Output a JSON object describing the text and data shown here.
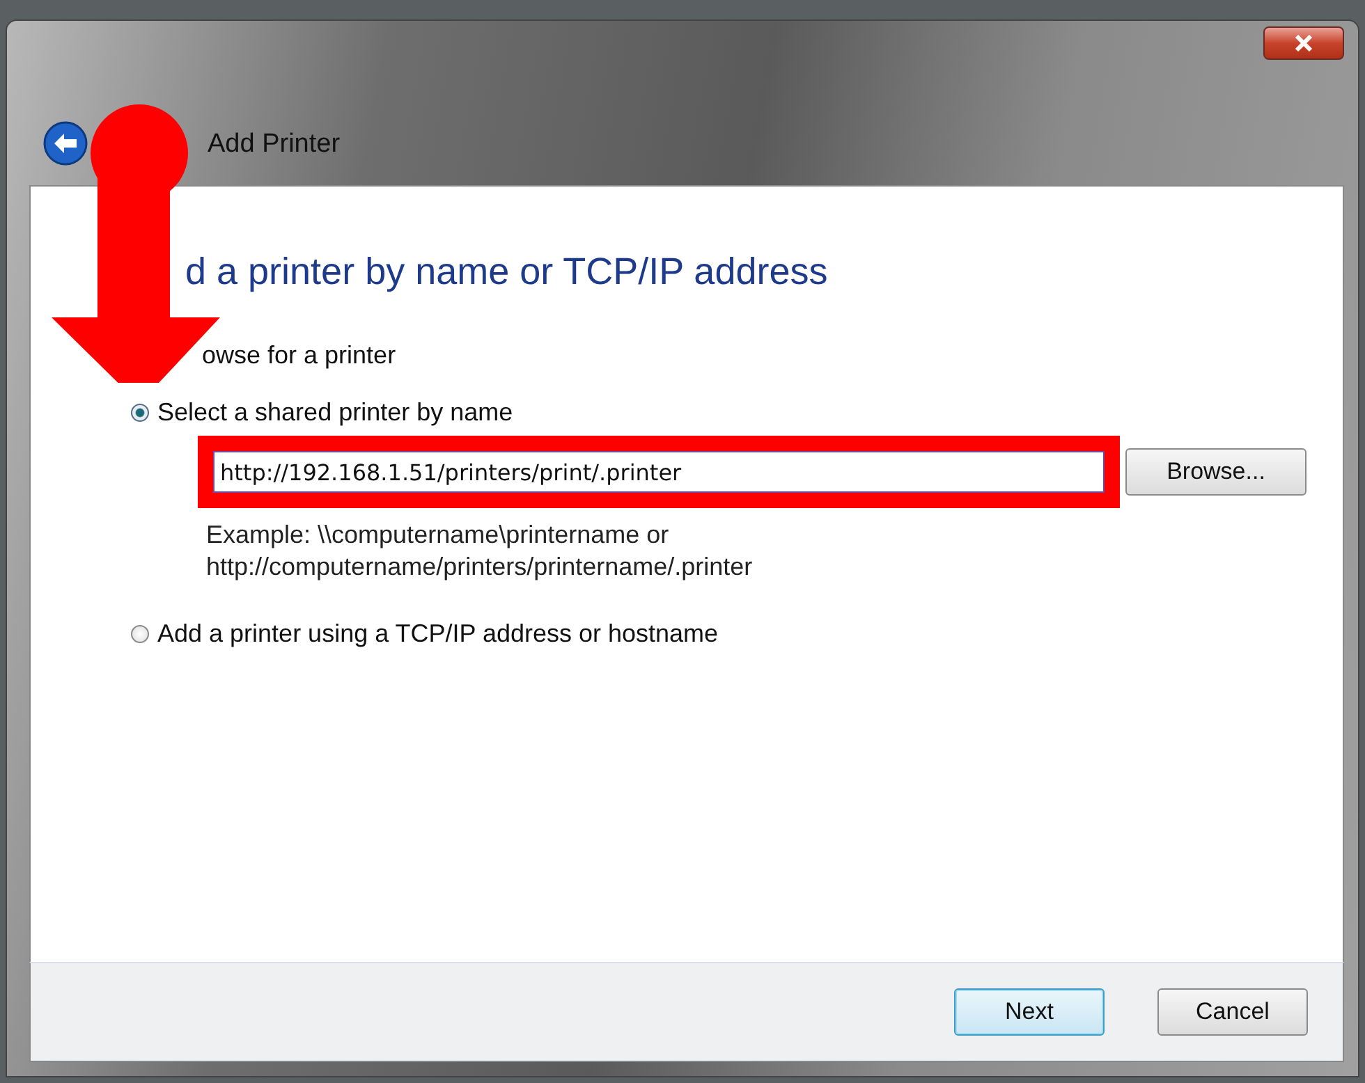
{
  "window": {
    "title": "Add Printer"
  },
  "heading": "d a printer by name or TCP/IP address",
  "partial_option_label": "owse for a printer",
  "options": [
    {
      "label": "Select a shared printer by name",
      "selected": true
    },
    {
      "label": "Add a printer using a TCP/IP address or hostname",
      "selected": false
    }
  ],
  "printer_field": {
    "value": "http://192.168.1.51/printers/print/.printer"
  },
  "browse_button": "Browse...",
  "example_lines": [
    "Example: \\\\computername\\printername or",
    "http://computername/printers/printername/.printer"
  ],
  "buttons": [
    {
      "label": "Next",
      "kind": "default"
    },
    {
      "label": "Cancel",
      "kind": "normal"
    }
  ]
}
